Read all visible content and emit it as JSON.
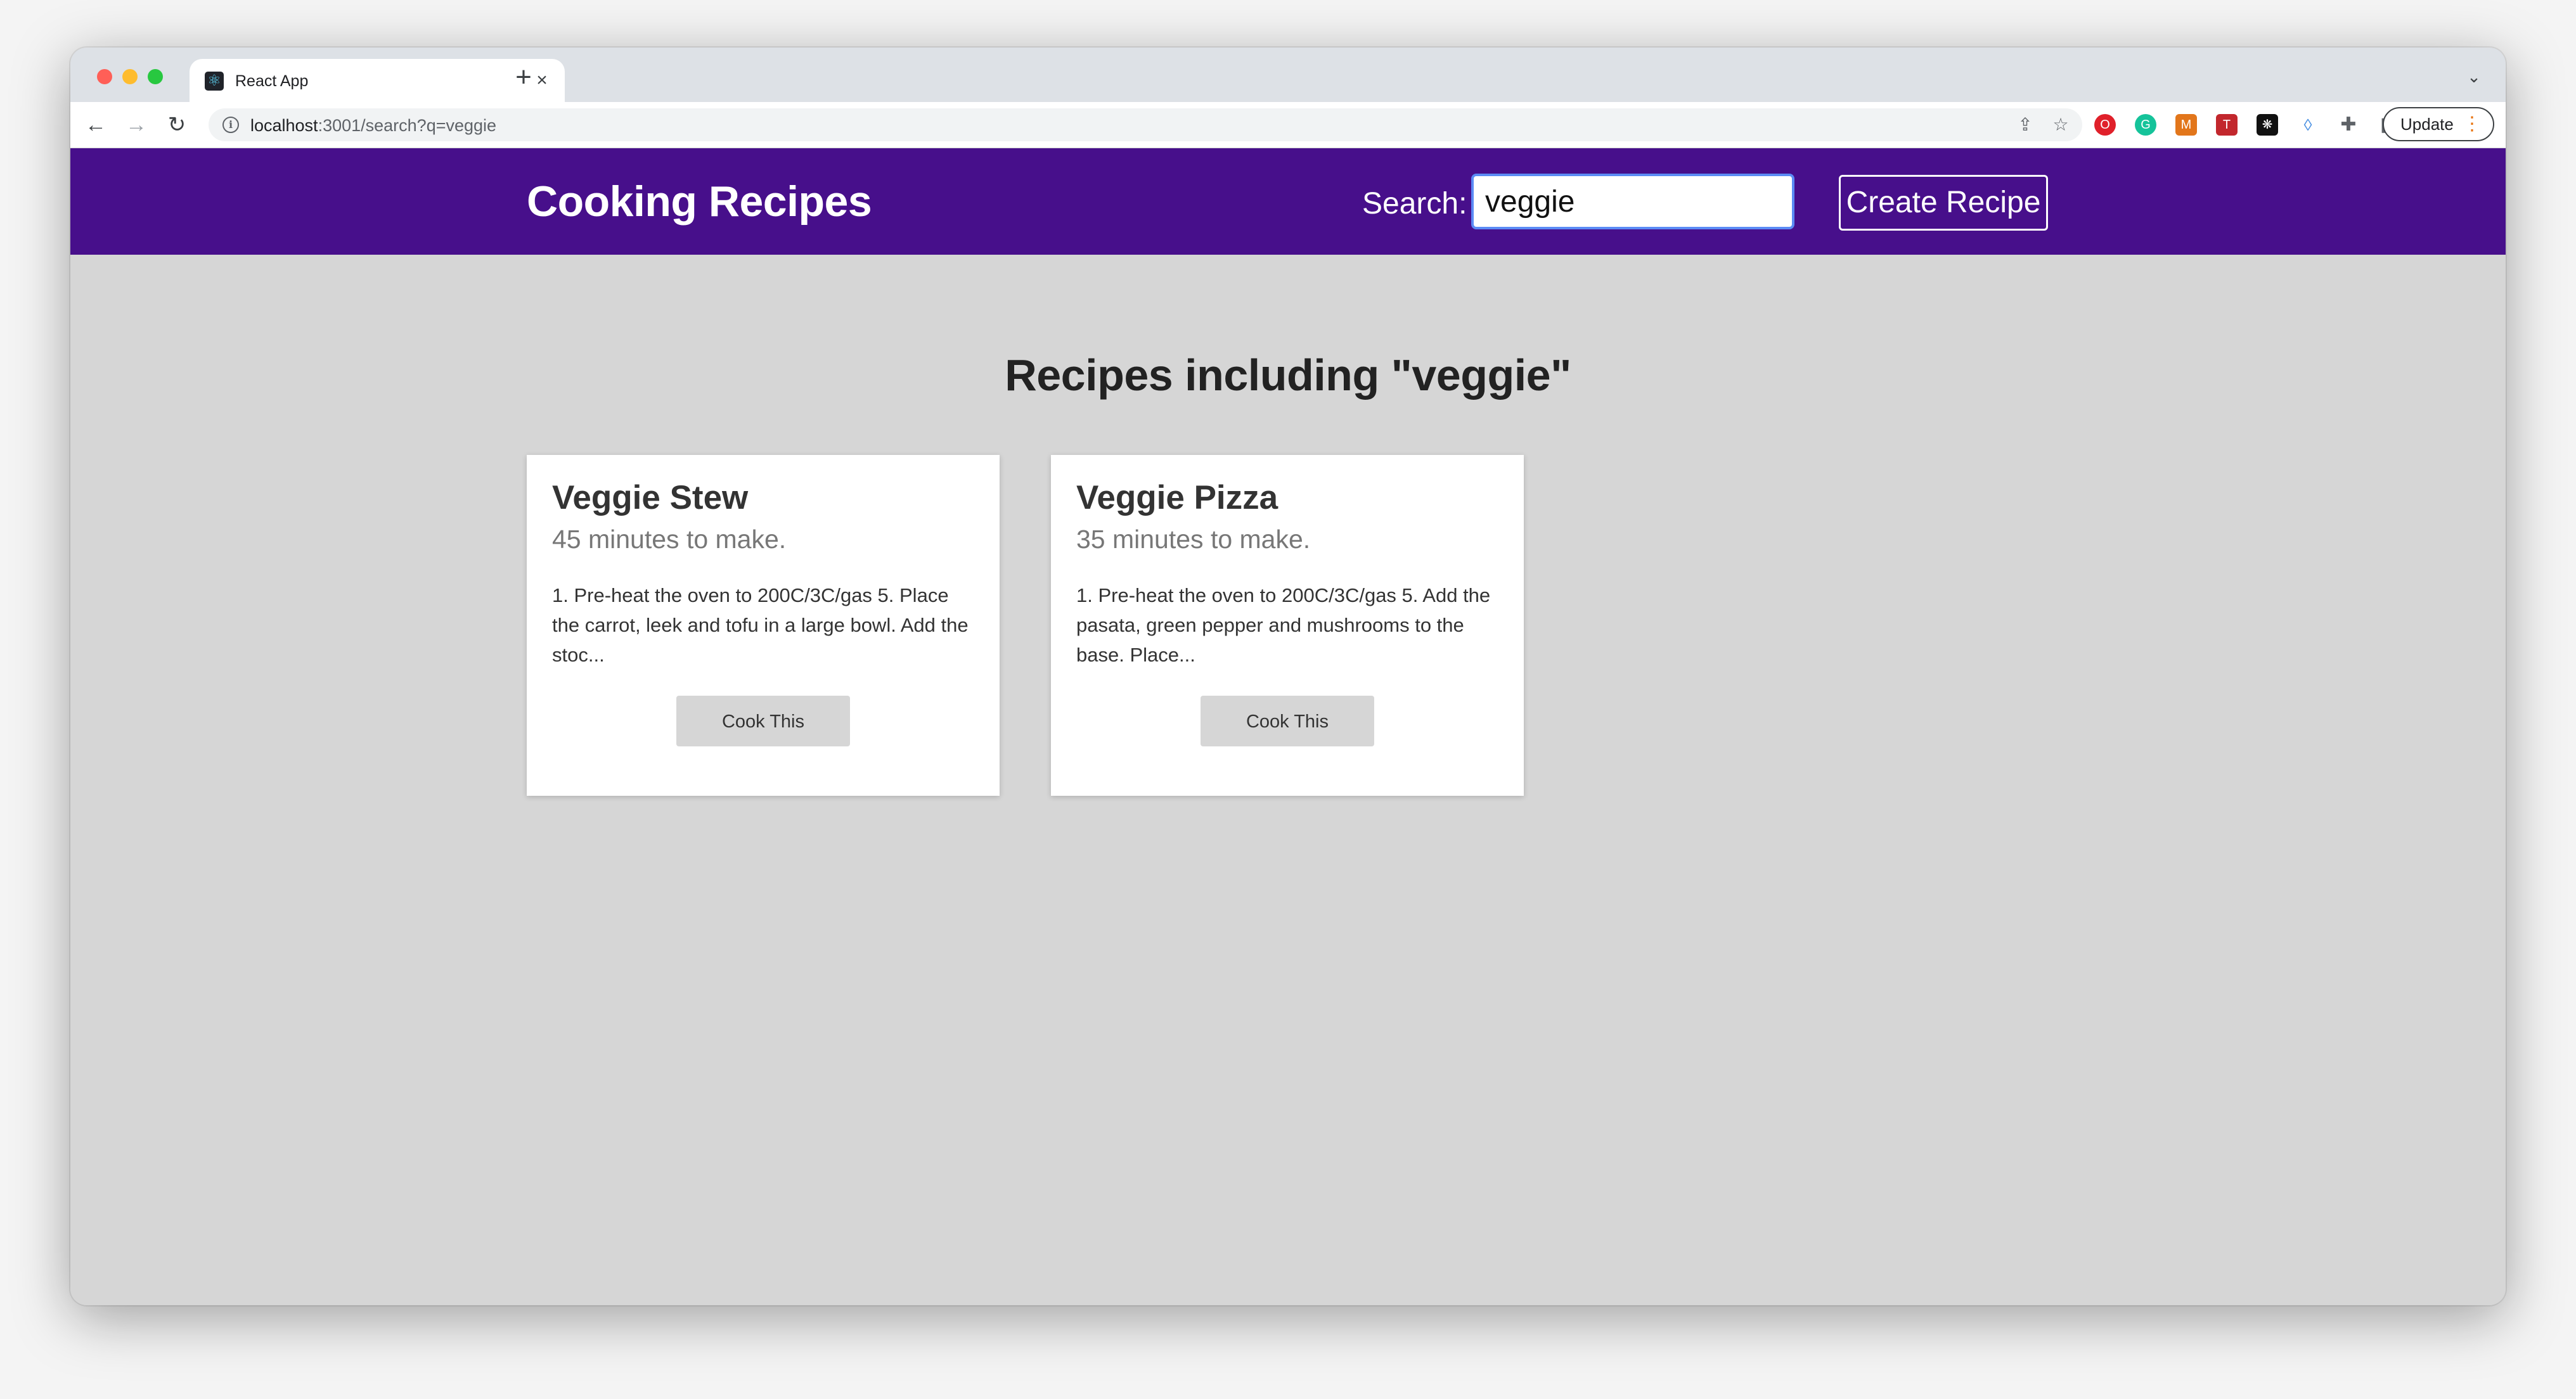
{
  "browser": {
    "tab_title": "React App",
    "favicon_icon": "react-icon",
    "url_host": "localhost",
    "url_rest": ":3001/search?q=veggie",
    "update_label": "Update",
    "extensions": [
      {
        "name": "opera-icon",
        "color": "#e0202a",
        "glyph": "O"
      },
      {
        "name": "grammarly-icon",
        "color": "#15c39a",
        "glyph": "G"
      },
      {
        "name": "metamask-icon",
        "color": "#e2761b",
        "glyph": "M"
      },
      {
        "name": "toggl-icon",
        "color": "#c2272d",
        "glyph": "T"
      },
      {
        "name": "settings-extension-icon",
        "color": "#111111",
        "glyph": "❋"
      },
      {
        "name": "droplet-icon",
        "color": "#ffffff",
        "glyph": "💧"
      }
    ]
  },
  "app": {
    "title": "Cooking Recipes",
    "search_label": "Search:",
    "search_value": "veggie",
    "create_label": "Create Recipe",
    "header_color": "#470f8b"
  },
  "results": {
    "heading": "Recipes including \"veggie\"",
    "cards": [
      {
        "title": "Veggie Stew",
        "time": "45 minutes to make.",
        "desc": "1. Pre-heat the oven to 200C/3C/gas 5. Place the carrot, leek and tofu in a large bowl. Add the stoc...",
        "button": "Cook This"
      },
      {
        "title": "Veggie Pizza",
        "time": "35 minutes to make.",
        "desc": "1. Pre-heat the oven to 200C/3C/gas 5. Add the pasata, green pepper and mushrooms to the base. Place...",
        "button": "Cook This"
      }
    ]
  }
}
